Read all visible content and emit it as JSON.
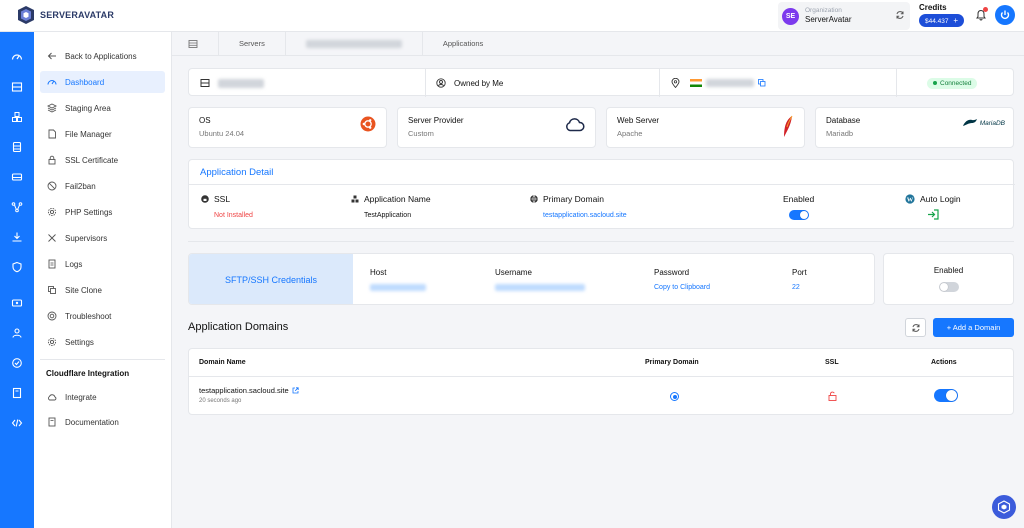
{
  "brand": {
    "name": "SERVERAVATAR"
  },
  "org": {
    "label": "Organization",
    "name": "ServerAvatar",
    "avatar": "SE"
  },
  "credits": {
    "label": "Credits",
    "amount": "$44.437"
  },
  "sidebar": {
    "items": [
      {
        "label": "Back to Applications",
        "icon": "arrow-left-icon"
      },
      {
        "label": "Dashboard",
        "icon": "dashboard-icon",
        "active": true
      },
      {
        "label": "Staging Area",
        "icon": "layers-icon"
      },
      {
        "label": "File Manager",
        "icon": "file-icon"
      },
      {
        "label": "SSL Certificate",
        "icon": "lock-icon"
      },
      {
        "label": "Fail2ban",
        "icon": "ban-icon"
      },
      {
        "label": "PHP Settings",
        "icon": "gear-icon"
      },
      {
        "label": "Supervisors",
        "icon": "tools-icon"
      },
      {
        "label": "Logs",
        "icon": "doc-icon"
      },
      {
        "label": "Site Clone",
        "icon": "copy-icon"
      },
      {
        "label": "Troubleshoot",
        "icon": "lifebuoy-icon"
      },
      {
        "label": "Settings",
        "icon": "gear-icon"
      }
    ],
    "section_heading": "Cloudflare Integration",
    "section_items": [
      {
        "label": "Integrate",
        "icon": "cloud-icon"
      },
      {
        "label": "Documentation",
        "icon": "book-icon"
      }
    ]
  },
  "breadcrumb": {
    "servers": "Servers",
    "applications": "Applications"
  },
  "info": {
    "owned_by": "Owned by Me",
    "status": "Connected"
  },
  "stats": [
    {
      "title": "OS",
      "value": "Ubuntu 24.04",
      "icon": "ubuntu-icon"
    },
    {
      "title": "Server Provider",
      "value": "Custom",
      "icon": "cloud-icon"
    },
    {
      "title": "Web Server",
      "value": "Apache",
      "icon": "apache-feather-icon"
    },
    {
      "title": "Database",
      "value": "Mariadb",
      "icon": "mariadb-icon",
      "icon_text": "MariaDB"
    }
  ],
  "app_detail": {
    "title": "Application Detail",
    "ssl_label": "SSL",
    "ssl_value": "Not Installed",
    "name_label": "Application Name",
    "name_value": "TestApplication",
    "domain_label": "Primary Domain",
    "domain_value": "testapplication.sacloud.site",
    "enabled_label": "Enabled",
    "enabled": true,
    "autologin_label": "Auto Login"
  },
  "sftp": {
    "title": "SFTP/SSH Credentials",
    "host_label": "Host",
    "username_label": "Username",
    "password_label": "Password",
    "password_value": "Copy to Clipboard",
    "port_label": "Port",
    "port_value": "22",
    "enabled_label": "Enabled",
    "enabled": false
  },
  "domains": {
    "title": "Application Domains",
    "add_button": "+ Add a Domain",
    "columns": [
      "Domain Name",
      "Primary Domain",
      "SSL",
      "Actions"
    ],
    "rows": [
      {
        "name": "testapplication.sacloud.site",
        "time": "20 seconds ago",
        "primary": true,
        "active": true
      }
    ]
  },
  "colors": {
    "accent": "#1677ff",
    "danger": "#ef4444",
    "success": "#16a34a"
  }
}
